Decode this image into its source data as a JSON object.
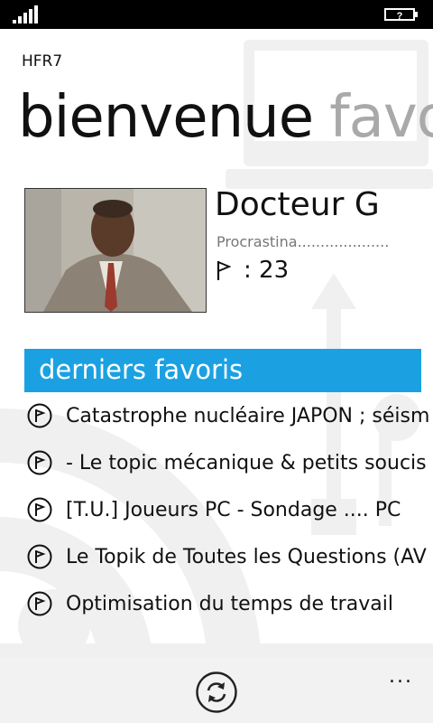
{
  "header": {
    "app_name": "HFR7",
    "pivot_active": "bienvenue",
    "pivot_next": "favo"
  },
  "profile": {
    "name": "Docteur G",
    "status": "Procrastina....................",
    "message_count_text": ": 23"
  },
  "favorites": {
    "title": "derniers favoris",
    "items": [
      {
        "label": "Catastrophe nucléaire JAPON ; séism"
      },
      {
        "label": "- Le topic mécanique & petits soucis"
      },
      {
        "label": "[T.U.] Joueurs PC - Sondage .... PC"
      },
      {
        "label": "Le Topik de Toutes les Questions (AV"
      },
      {
        "label": "Optimisation du temps de travail"
      }
    ]
  },
  "app_bar": {
    "more_label": "..."
  },
  "colors": {
    "accent": "#1ba1e2",
    "status_bar": "#000000",
    "app_bar": "#f2f2f2"
  },
  "icons": {
    "signal": "signal-strength-icon",
    "battery": "battery-icon",
    "flag": "flag-icon",
    "item": "circle-flag-icon",
    "refresh": "refresh-icon"
  }
}
